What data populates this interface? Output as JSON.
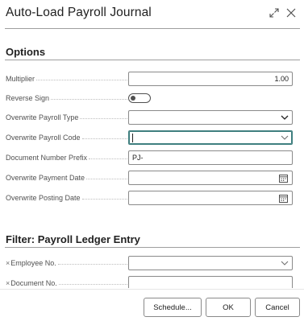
{
  "dialog": {
    "title": "Auto-Load Payroll Journal",
    "expand_icon": "expand-icon",
    "close_icon": "close-icon"
  },
  "options": {
    "section_title": "Options",
    "multiplier": {
      "label": "Multiplier",
      "value": "1.00"
    },
    "reverse_sign": {
      "label": "Reverse Sign",
      "value": false
    },
    "overwrite_payroll_type": {
      "label": "Overwrite Payroll Type",
      "value": ""
    },
    "overwrite_payroll_code": {
      "label": "Overwrite Payroll Code",
      "value": ""
    },
    "document_number_prefix": {
      "label": "Document Number Prefix",
      "value": "PJ-"
    },
    "overwrite_payment_date": {
      "label": "Overwrite Payment Date",
      "value": ""
    },
    "overwrite_posting_date": {
      "label": "Overwrite Posting Date",
      "value": ""
    }
  },
  "filter": {
    "section_title": "Filter: Payroll Ledger Entry",
    "remove_symbol": "×",
    "employee_no": {
      "label": "Employee No.",
      "value": ""
    },
    "document_no": {
      "label": "Document No.",
      "value": ""
    }
  },
  "footer": {
    "schedule_label": "Schedule...",
    "ok_label": "OK",
    "cancel_label": "Cancel"
  },
  "colors": {
    "focus_border": "#3f7f7f",
    "field_border": "#8a8a8a",
    "text": "#212121",
    "label_text": "#505050"
  }
}
